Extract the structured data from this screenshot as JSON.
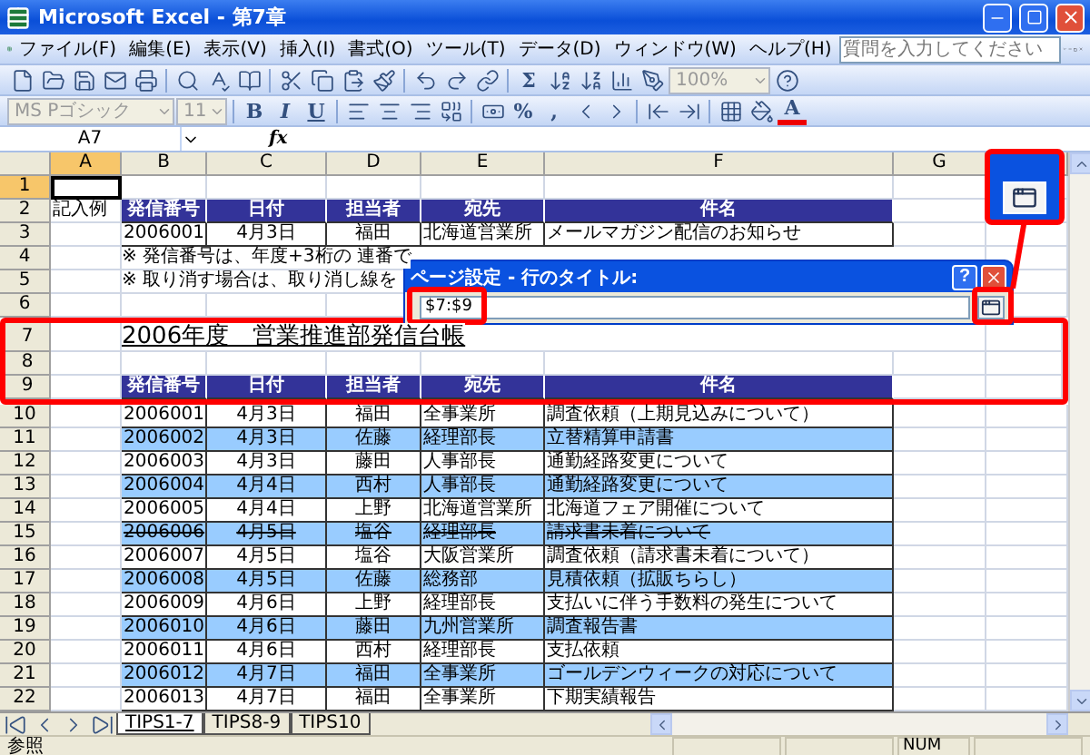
{
  "window": {
    "title": "Microsoft Excel - 第7章"
  },
  "menu": [
    "ファイル(F)",
    "編集(E)",
    "表示(V)",
    "挿入(I)",
    "書式(O)",
    "ツール(T)",
    "データ(D)",
    "ウィンドウ(W)",
    "ヘルプ(H)"
  ],
  "help_box": {
    "placeholder": "質問を入力してください"
  },
  "standard_toolbar": {
    "sum": "Σ",
    "zoom": "100%"
  },
  "formatting_toolbar": {
    "font": "MS Pゴシック",
    "size": "11",
    "bold": "B",
    "italic": "I",
    "underline": "U",
    "percent": "%",
    "comma": ",",
    "font_color": "A"
  },
  "formula_bar": {
    "name_box": "A7",
    "fx": "fx"
  },
  "columns": [
    {
      "label": "A",
      "selected": true
    },
    {
      "label": "B",
      "selected": false
    },
    {
      "label": "C",
      "selected": false
    },
    {
      "label": "D",
      "selected": false
    },
    {
      "label": "E",
      "selected": false
    },
    {
      "label": "F",
      "selected": false
    },
    {
      "label": "G",
      "selected": false
    }
  ],
  "rows": [
    {
      "number": "1",
      "selected": true,
      "kind": "blank"
    },
    {
      "number": "2",
      "selected": false,
      "kind": "header",
      "a": "記入例",
      "cells": [
        "発信番号",
        "日付",
        "担当者",
        "宛先",
        "件名"
      ]
    },
    {
      "number": "3",
      "selected": false,
      "kind": "data",
      "highlighted": false,
      "struck": false,
      "cells": [
        "2006001",
        "4月3日",
        "福田",
        "北海道営業所",
        "メールマガジン配信のお知らせ"
      ]
    },
    {
      "number": "4",
      "selected": false,
      "kind": "note",
      "text": "※ 発信番号は、年度+3桁の 連番で"
    },
    {
      "number": "5",
      "selected": false,
      "kind": "note",
      "text": "※ 取り消す場合は、取り消し線を"
    },
    {
      "number": "6",
      "selected": false,
      "kind": "blank"
    },
    {
      "number": "7",
      "selected": false,
      "kind": "title",
      "text": "2006年度　営業推進部発信台帳"
    },
    {
      "number": "8",
      "selected": false,
      "kind": "blank"
    },
    {
      "number": "9",
      "selected": false,
      "kind": "header",
      "cells": [
        "発信番号",
        "日付",
        "担当者",
        "宛先",
        "件名"
      ]
    },
    {
      "number": "10",
      "selected": false,
      "kind": "data",
      "highlighted": false,
      "struck": false,
      "cells": [
        "2006001",
        "4月3日",
        "福田",
        "全事業所",
        "調査依頼（上期見込みについて）"
      ]
    },
    {
      "number": "11",
      "selected": false,
      "kind": "data",
      "highlighted": true,
      "struck": false,
      "cells": [
        "2006002",
        "4月3日",
        "佐藤",
        "経理部長",
        "立替精算申請書"
      ]
    },
    {
      "number": "12",
      "selected": false,
      "kind": "data",
      "highlighted": false,
      "struck": false,
      "cells": [
        "2006003",
        "4月3日",
        "藤田",
        "人事部長",
        "通勤経路変更について"
      ]
    },
    {
      "number": "13",
      "selected": false,
      "kind": "data",
      "highlighted": true,
      "struck": false,
      "cells": [
        "2006004",
        "4月4日",
        "西村",
        "人事部長",
        "通勤経路変更について"
      ]
    },
    {
      "number": "14",
      "selected": false,
      "kind": "data",
      "highlighted": false,
      "struck": false,
      "cells": [
        "2006005",
        "4月4日",
        "上野",
        "北海道営業所",
        "北海道フェア開催について"
      ]
    },
    {
      "number": "15",
      "selected": false,
      "kind": "data",
      "highlighted": true,
      "struck": true,
      "cells": [
        "2006006",
        "4月5日",
        "塩谷",
        "経理部長",
        "請求書未着について"
      ]
    },
    {
      "number": "16",
      "selected": false,
      "kind": "data",
      "highlighted": false,
      "struck": false,
      "cells": [
        "2006007",
        "4月5日",
        "塩谷",
        "大阪営業所",
        "調査依頼（請求書未着について）"
      ]
    },
    {
      "number": "17",
      "selected": false,
      "kind": "data",
      "highlighted": true,
      "struck": false,
      "cells": [
        "2006008",
        "4月5日",
        "佐藤",
        "総務部",
        "見積依頼（拡販ちらし）"
      ]
    },
    {
      "number": "18",
      "selected": false,
      "kind": "data",
      "highlighted": false,
      "struck": false,
      "cells": [
        "2006009",
        "4月6日",
        "上野",
        "経理部長",
        "支払いに伴う手数料の発生について"
      ]
    },
    {
      "number": "19",
      "selected": false,
      "kind": "data",
      "highlighted": true,
      "struck": false,
      "cells": [
        "2006010",
        "4月6日",
        "藤田",
        "九州営業所",
        "調査報告書"
      ]
    },
    {
      "number": "20",
      "selected": false,
      "kind": "data",
      "highlighted": false,
      "struck": false,
      "cells": [
        "2006011",
        "4月6日",
        "西村",
        "経理部長",
        "支払依頼"
      ]
    },
    {
      "number": "21",
      "selected": false,
      "kind": "data",
      "highlighted": true,
      "struck": false,
      "cells": [
        "2006012",
        "4月7日",
        "福田",
        "全事業所",
        "ゴールデンウィークの対応について"
      ]
    },
    {
      "number": "22",
      "selected": false,
      "kind": "data",
      "highlighted": false,
      "struck": false,
      "cells": [
        "2006013",
        "4月7日",
        "福田",
        "全事業所",
        "下期実績報告"
      ]
    }
  ],
  "dialog": {
    "title": "ページ設定 - 行のタイトル:",
    "help": "?",
    "value": "$7:$9"
  },
  "sheet_tabs": [
    {
      "label": "TIPS1-7",
      "selected": true
    },
    {
      "label": "TIPS8-9",
      "selected": false
    },
    {
      "label": "TIPS10",
      "selected": false
    }
  ],
  "status_bar": {
    "mode": "参照",
    "num": "NUM"
  }
}
